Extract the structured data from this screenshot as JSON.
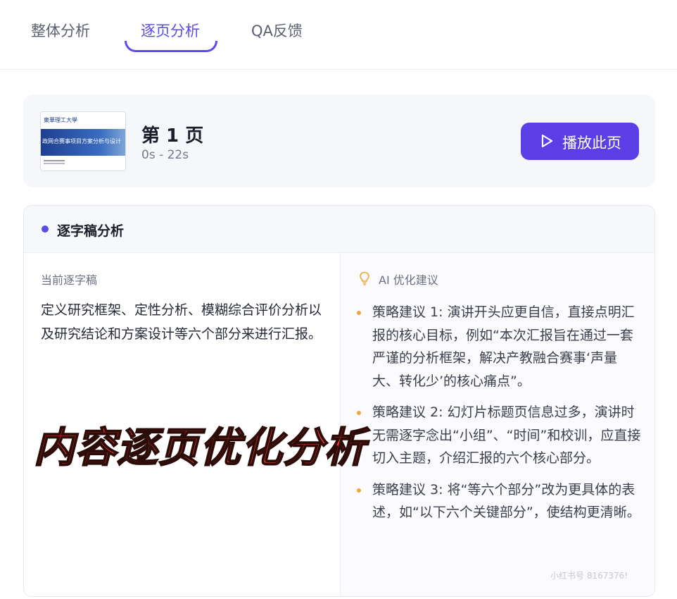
{
  "tabs": [
    {
      "label": "整体分析",
      "active": false
    },
    {
      "label": "逐页分析",
      "active": true
    },
    {
      "label": "QA反馈",
      "active": false
    }
  ],
  "page": {
    "thumbnail": {
      "logo_text": "東華理工大學",
      "banner_text": "政网合赛事项目方案分析与设计"
    },
    "title": "第 1 页",
    "time_range": "0s - 22s",
    "play_label": "播放此页"
  },
  "analysis": {
    "title": "逐字稿分析",
    "transcript_label": "当前逐字稿",
    "transcript": "定义研究框架、定性分析、模糊综合评价分析以及研究结论和方案设计等六个部分来进行汇报。",
    "ai_label": "AI 优化建议",
    "suggestions": [
      "策略建议 1: 演讲开头应更自信，直接点明汇报的核心目标，例如“本次汇报旨在通过一套严谨的分析框架，解决产教融合赛事‘声量大、转化少’的核心痛点”。",
      "策略建议 2: 幻灯片标题页信息过多，演讲时无需逐字念出“小组”、“时间”和校训，应直接切入主题，介绍汇报的六个核心部分。",
      "策略建议 3: 将“等六个部分”改为更具体的表述，如“以下六个关键部分”，使结构更清晰。"
    ]
  },
  "overlay_caption": "内容逐页优化分析",
  "watermark": "小红书号 8167376!",
  "colors": {
    "accent": "#5b3ee6",
    "bullet": "#f0a53a",
    "overlay": "#f03a2a"
  }
}
